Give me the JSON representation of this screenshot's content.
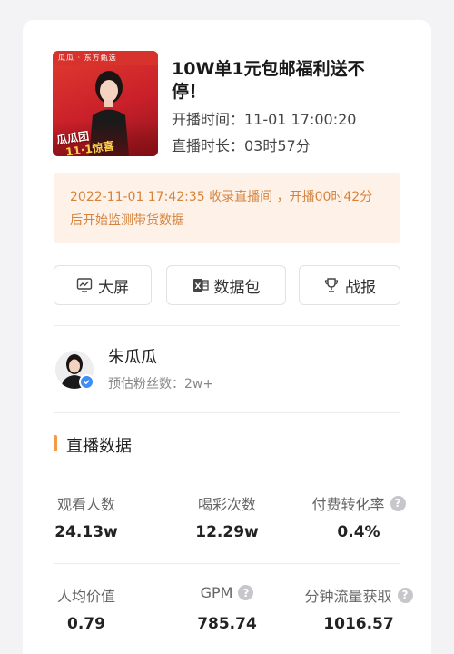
{
  "live": {
    "title": "10W单1元包邮福利送不停！",
    "start_time": "开播时间：11-01 17:00:20",
    "duration": "直播时长：03时57分",
    "thumbnail": {
      "brand_text": "瓜瓜 · 东方甄选",
      "caption_line1": "瓜瓜团",
      "caption_line2": "11·1惊喜"
    }
  },
  "notice": {
    "text": "2022-11-01 17:42:35 收录直播间 ，开播00时42分后开始监测带货数据"
  },
  "actions": [
    {
      "label": "大屏",
      "icon": "monitor-chart-icon"
    },
    {
      "label": "数据包",
      "icon": "excel-icon"
    },
    {
      "label": "战报",
      "icon": "trophy-icon"
    }
  ],
  "streamer": {
    "name": "朱瓜瓜",
    "fans": "预估粉丝数：2w+",
    "verified_color": "#3e8ef7"
  },
  "section": {
    "title": "直播数据",
    "accent": "#f39a4a"
  },
  "stats": [
    {
      "label": "观看人数",
      "value": "24.13w",
      "help": false
    },
    {
      "label": "喝彩次数",
      "value": "12.29w",
      "help": false
    },
    {
      "label": "付费转化率",
      "value": "0.4%",
      "help": true
    },
    {
      "label": "人均价值",
      "value": "0.79",
      "help": false
    },
    {
      "label": "GPM",
      "value": "785.74",
      "help": true
    },
    {
      "label": "分钟流量获取",
      "value": "1016.57",
      "help": true
    }
  ],
  "help_glyph": "?"
}
